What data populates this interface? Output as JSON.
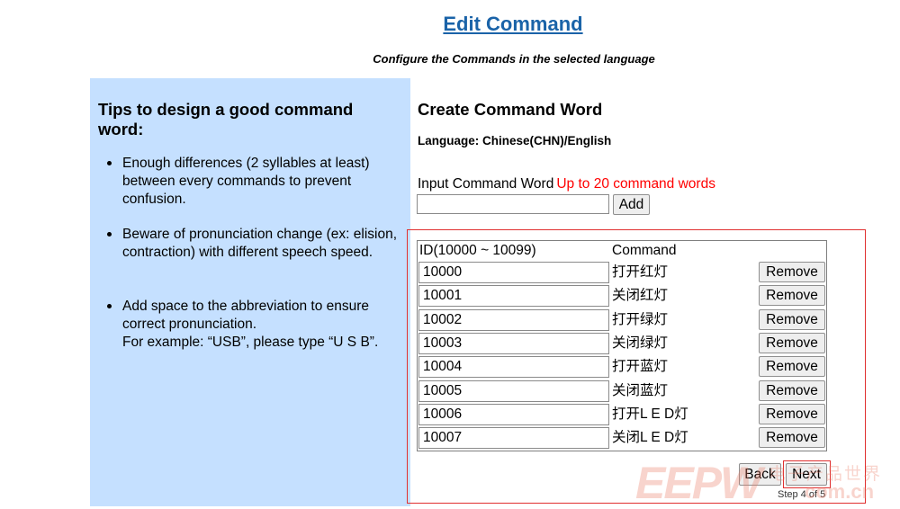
{
  "page": {
    "title": "Edit Command",
    "subtitle": "Configure the Commands in the selected language"
  },
  "tips": {
    "heading": "Tips to design a good command word:",
    "items": [
      "Enough differences (2 syllables at least) between every commands to prevent confusion.",
      "Beware of pronunciation change (ex: elision, contraction) with different speech speed.",
      "Add space to the abbreviation to ensure correct pronunciation.",
      "For example: “USB”, please type “U S B”."
    ]
  },
  "editor": {
    "heading": "Create Command Word",
    "language_label": "Language: Chinese(CHN)/English",
    "input_label": "Input Command Word",
    "input_hint": "Up to 20 command words",
    "input_value": "",
    "add_label": "Add",
    "table": {
      "headers": [
        "ID(10000 ~ 10099)",
        "Command"
      ],
      "remove_label": "Remove",
      "rows": [
        {
          "id": "10000",
          "command": "打开红灯"
        },
        {
          "id": "10001",
          "command": "关闭红灯"
        },
        {
          "id": "10002",
          "command": "打开绿灯"
        },
        {
          "id": "10003",
          "command": "关闭绿灯"
        },
        {
          "id": "10004",
          "command": "打开蓝灯"
        },
        {
          "id": "10005",
          "command": "关闭蓝灯"
        },
        {
          "id": "10006",
          "command": "打开L E D灯"
        },
        {
          "id": "10007",
          "command": "关闭L E D灯"
        }
      ]
    },
    "back_label": "Back",
    "next_label": "Next",
    "step_label": "Step 4 of 5"
  },
  "watermark": {
    "main": "EEPW",
    "cn": "电子产品世界",
    "sub": "com.cn"
  }
}
